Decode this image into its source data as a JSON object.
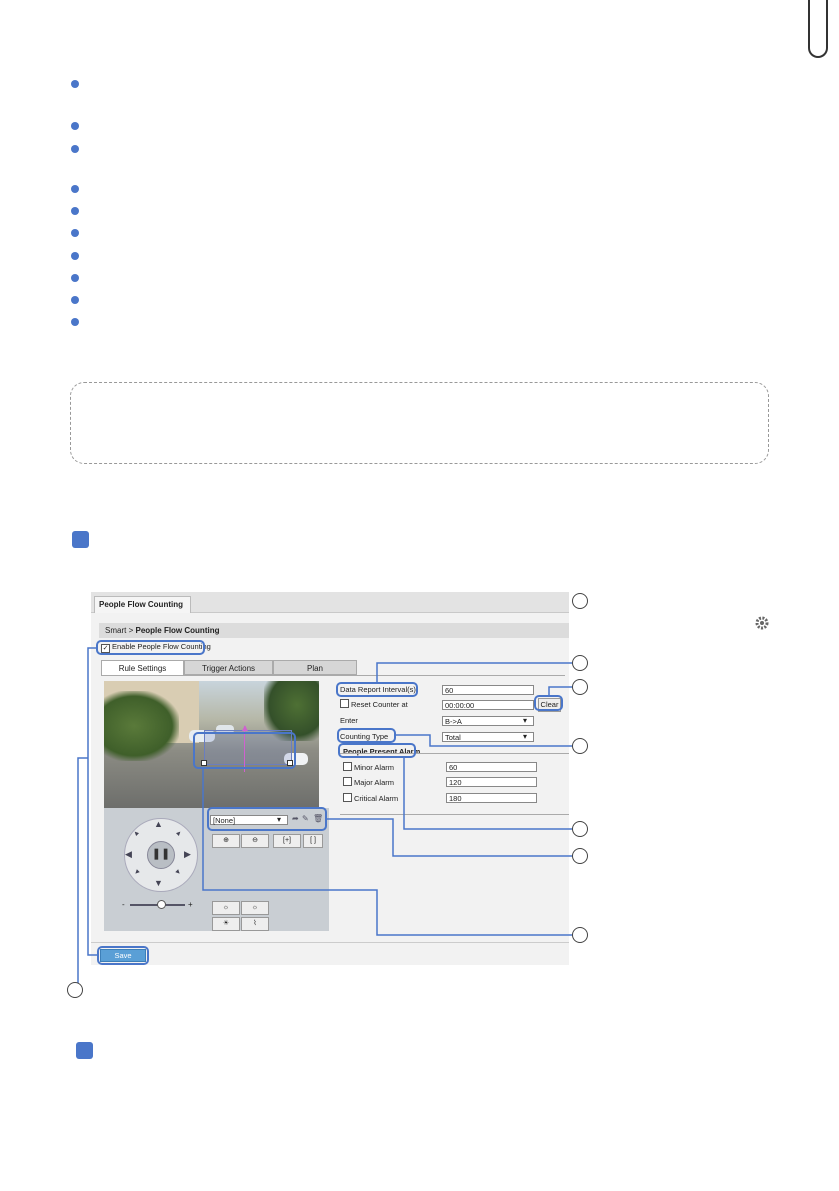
{
  "screenshot": {
    "tab_title": "People Flow Counting",
    "breadcrumb": {
      "root": "Smart",
      "separator": ">",
      "current": "People Flow Counting"
    },
    "enable_label": "Enable People Flow Counting",
    "tabs": [
      "Rule Settings",
      "Trigger Actions",
      "Plan"
    ],
    "fields": {
      "data_report_interval_label": "Data Report Interval(s)",
      "data_report_interval_value": "60",
      "reset_counter_label": "Reset Counter at",
      "reset_counter_value": "00:00:00",
      "clear_button": "Clear",
      "enter_label": "Enter",
      "enter_value": "B->A",
      "counting_type_label": "Counting Type",
      "counting_type_value": "Total"
    },
    "people_present_alarm": {
      "heading": "People Present Alarm",
      "rows": [
        {
          "label": "Minor Alarm",
          "value": "60"
        },
        {
          "label": "Major Alarm",
          "value": "120"
        },
        {
          "label": "Critical Alarm",
          "value": "180"
        }
      ]
    },
    "preset_select": "[None]",
    "slider_minus": "-",
    "slider_plus": "+",
    "save_button": "Save"
  },
  "colors": {
    "accent": "#4a76c9",
    "highlight_border": "#4a76c9"
  },
  "icons": [
    "gear-icon",
    "play-pause-icon",
    "zoom-in-icon",
    "zoom-out-icon"
  ]
}
